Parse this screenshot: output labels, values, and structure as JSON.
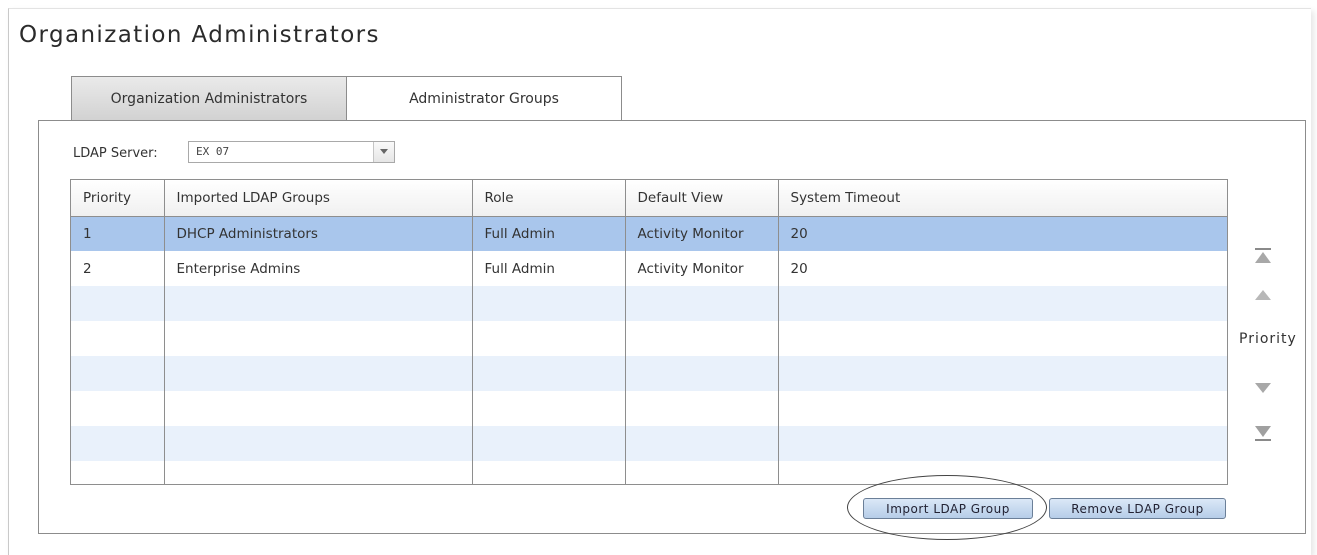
{
  "page": {
    "title": "Organization Administrators"
  },
  "tabs": [
    {
      "label": "Organization Administrators",
      "active": true
    },
    {
      "label": "Administrator Groups",
      "active": false
    }
  ],
  "ldap": {
    "label": "LDAP Server:",
    "selected": "EX 07"
  },
  "table": {
    "columns": [
      "Priority",
      "Imported LDAP Groups",
      "Role",
      "Default View",
      "System Timeout"
    ],
    "rows": [
      {
        "priority": "1",
        "group": "DHCP Administrators",
        "role": "Full Admin",
        "view": "Activity Monitor",
        "timeout": "20",
        "selected": true
      },
      {
        "priority": "2",
        "group": "Enterprise Admins",
        "role": "Full Admin",
        "view": "Activity Monitor",
        "timeout": "20",
        "selected": false
      }
    ],
    "selected_row_color": "#a9c6ec",
    "alt_row_color": "#e9f1fb"
  },
  "priority_controls": {
    "label": "Priority",
    "icons": [
      "move-to-top-icon",
      "move-up-icon",
      "move-down-icon",
      "move-to-bottom-icon"
    ]
  },
  "buttons": {
    "import": "Import LDAP Group",
    "remove": "Remove LDAP Group"
  }
}
